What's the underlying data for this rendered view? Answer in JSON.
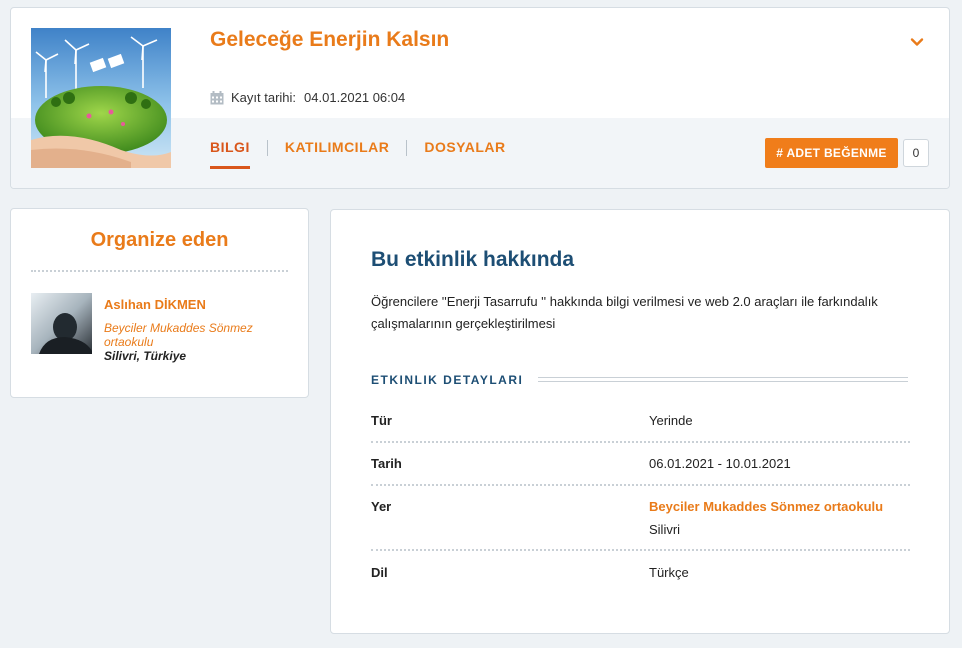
{
  "event": {
    "title": "Geleceğe Enerjin Kalsın",
    "registration_label": "Kayıt tarihi:",
    "registration_date": "04.01.2021 06:04",
    "collapse_icon": "chevron-down-icon",
    "calendar_icon": "calendar-icon"
  },
  "tabs": [
    {
      "label": "BILGI",
      "active": true
    },
    {
      "label": "KATILIMCILAR",
      "active": false
    },
    {
      "label": "DOSYALAR",
      "active": false
    }
  ],
  "like": {
    "button_label": "# ADET BEĞENME",
    "count": "0"
  },
  "organizer": {
    "heading": "Organize eden",
    "name": "Aslıhan DİKMEN",
    "school": "Beyciler Mukaddes Sönmez ortaokulu",
    "location": "Silivri, Türkiye"
  },
  "about": {
    "heading": "Bu etkinlik hakkında",
    "text": "Öğrencilere ''Enerji Tasarrufu '' hakkında bilgi verilmesi ve web 2.0 araçları ile farkındalık çalışmalarının gerçekleştirilmesi",
    "details_heading": "ETKINLIK DETAYLARI",
    "details": [
      {
        "label": "Tür",
        "value": "Yerinde"
      },
      {
        "label": "Tarih",
        "value": "06.01.2021 - 10.01.2021"
      },
      {
        "label": "Yer",
        "value": "Beyciler Mukaddes Sönmez ortaokulu",
        "sub": "Silivri"
      },
      {
        "label": "Dil",
        "value": "Türkçe"
      }
    ]
  },
  "colors": {
    "accent": "#e97b1a",
    "active_tab": "#d9561b",
    "heading_blue": "#1d4e74",
    "button": "#f07d1a"
  }
}
